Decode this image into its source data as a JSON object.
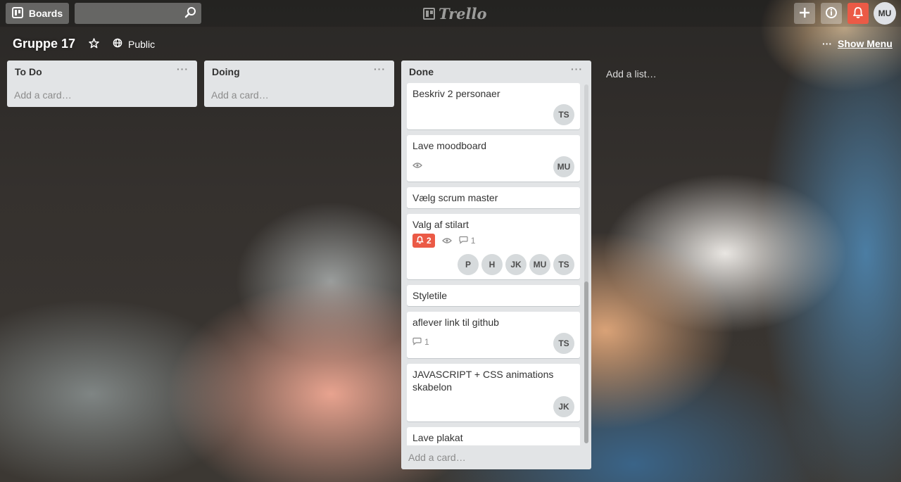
{
  "header": {
    "boards_label": "Boards",
    "search_value": "",
    "logo_text": "Trello",
    "user_initials": "MU"
  },
  "board": {
    "title": "Gruppe 17",
    "visibility": "Public",
    "show_menu_label": "Show Menu",
    "show_menu_dots": "···"
  },
  "lists": [
    {
      "title": "To Do",
      "menu": "···",
      "add_card": "Add a card…"
    },
    {
      "title": "Doing",
      "menu": "···",
      "add_card": "Add a card…"
    },
    {
      "title": "Done",
      "menu": "···",
      "add_card": "Add a card…",
      "cards": [
        {
          "title": "Beskriv 2 personaer",
          "members": [
            "TS"
          ]
        },
        {
          "title": "Lave moodboard",
          "watching": true,
          "members": [
            "MU"
          ]
        },
        {
          "title": "Vælg scrum master"
        },
        {
          "title": "Valg af stilart",
          "notifications": "2",
          "watching": true,
          "comments": "1",
          "members": [
            "P",
            "H",
            "JK",
            "MU",
            "TS"
          ]
        },
        {
          "title": "Styletile"
        },
        {
          "title": "aflever link til github",
          "comments": "1",
          "members": [
            "TS"
          ]
        },
        {
          "title": "JAVASCRIPT + CSS animations skabelon",
          "members": [
            "JK"
          ]
        },
        {
          "title": "Lave plakat"
        }
      ]
    }
  ],
  "add_list_label": "Add a list…",
  "colors": {
    "notification": "#eb5a46",
    "list_bg": "#e2e4e6"
  }
}
